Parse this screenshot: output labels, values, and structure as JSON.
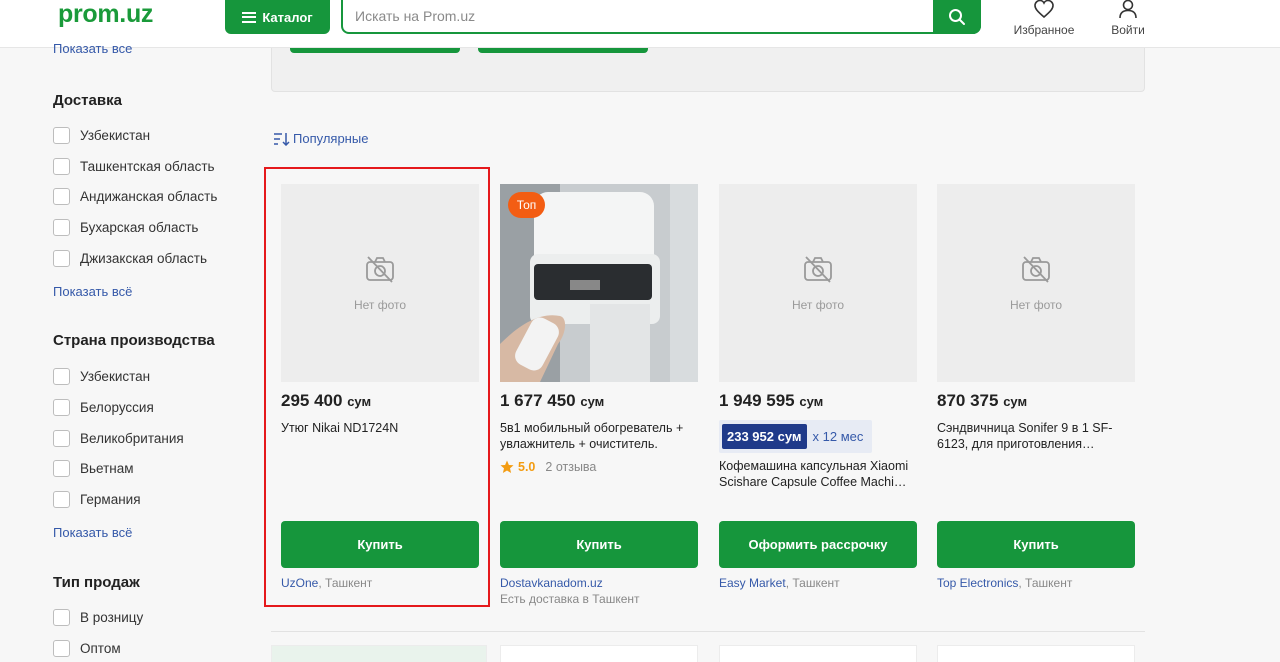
{
  "header": {
    "logo": "prom.uz",
    "catalog_label": "Каталог",
    "search_placeholder": "Искать на Prom.uz",
    "favorites_label": "Избранное",
    "login_label": "Войти"
  },
  "sidebar": {
    "show_all_top": "Показать все",
    "sections": [
      {
        "title": "Доставка",
        "items": [
          "Узбекистан",
          "Ташкентская область",
          "Андижанская область",
          "Бухарская область",
          "Джизакская область"
        ],
        "show_all": "Показать всё"
      },
      {
        "title": "Страна производства",
        "items": [
          "Узбекистан",
          "Белоруссия",
          "Великобритания",
          "Вьетнам",
          "Германия"
        ],
        "show_all": "Показать всё"
      },
      {
        "title": "Тип продаж",
        "items": [
          "В розницу",
          "Оптом"
        ]
      }
    ]
  },
  "sort": {
    "label": "Популярные"
  },
  "products": [
    {
      "price": "295 400",
      "currency": "сум",
      "title": "Утюг Nikai ND1724N",
      "no_photo": "Нет фото",
      "button": "Купить",
      "seller": "UzOne",
      "city": ", Ташкент"
    },
    {
      "badge": "Топ",
      "price": "1 677 450",
      "currency": "сум",
      "title": "5в1 мобильный обогреватель + увлажнитель + очиститель.",
      "rating": "5.0",
      "reviews": "2 отзыва",
      "button": "Купить",
      "seller": "Dostavkanadom.uz",
      "seller_note": "Есть доставка в Ташкент"
    },
    {
      "price": "1 949 595",
      "currency": "сум",
      "installment_amount": "233 952 сум",
      "installment_months": "x 12 мес",
      "title": "Кофемашина капсульная Xiaomi Scishare Capsule Coffee Machi…",
      "no_photo": "Нет фото",
      "button": "Оформить рассрочку",
      "seller": "Easy Market",
      "city": ", Ташкент"
    },
    {
      "price": "870 375",
      "currency": "сум",
      "title": "Сэндвичница Sonifer 9 в 1 SF-6123, для приготовления…",
      "no_photo": "Нет фото",
      "button": "Купить",
      "seller": "Top Electronics",
      "city": ", Ташкент"
    }
  ],
  "colors": {
    "brand_green": "#16963c",
    "link_blue": "#3559a9",
    "highlight_red": "#e5191c",
    "badge_orange": "#f35d13"
  }
}
